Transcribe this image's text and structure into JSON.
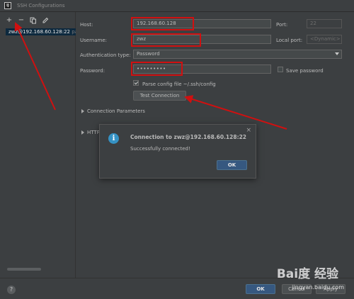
{
  "window": {
    "title": "SSH Configurations",
    "app_icon_text": "IJ"
  },
  "sidebar": {
    "items": [
      {
        "label": "zwz@192.168.60.128:22",
        "suffix": "pa"
      }
    ]
  },
  "form": {
    "host_label": "Host:",
    "host_value": "192.168.60.128",
    "port_label": "Port:",
    "port_value": "22",
    "username_label": "Username:",
    "username_value": "zwz",
    "local_port_label": "Local port:",
    "local_port_value": "<Dynamic>",
    "auth_label": "Authentication type:",
    "auth_value": "Password",
    "password_label": "Password:",
    "password_value": "•••••••••",
    "save_password_label": "Save password",
    "parse_config_label": "Parse config file ~/.ssh/config",
    "test_connection_label": "Test Connection",
    "connection_params_label": "Connection Parameters",
    "http_label": "HTTP"
  },
  "dialog": {
    "title": "Connection to zwz@192.168.60.128:22",
    "message": "Successfully connected!",
    "ok_label": "OK",
    "close_glyph": "×",
    "info_glyph": "i"
  },
  "footer": {
    "help_glyph": "?",
    "ok_label": "OK",
    "cancel_label": "Cancel",
    "apply_label": "Apply"
  },
  "watermark": {
    "brand": "Bai度 经验",
    "url": "jingyan.baidu.com"
  },
  "colors": {
    "annotation": "#d01010",
    "primary": "#365880",
    "info": "#3592c4"
  }
}
